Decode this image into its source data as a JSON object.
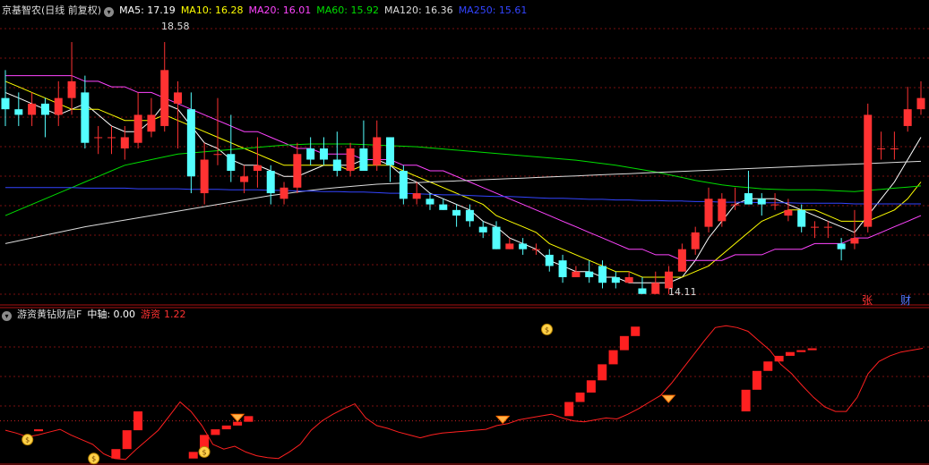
{
  "main_header": {
    "stock_name": "京基智农(日线 前复权)",
    "ma5": "MA5: 17.19",
    "ma10": "MA10: 16.28",
    "ma20": "MA20: 16.01",
    "ma60": "MA60: 15.92",
    "ma120": "MA120: 16.36",
    "ma250": "MA250: 15.61"
  },
  "sub_header": {
    "indicator_name": "游资黄钻财启F",
    "mid_axis": "中轴: 0.00",
    "hot_money_label": "游资",
    "hot_money_value": "1.22"
  },
  "annotations": {
    "high_marker": "18.58",
    "low_marker": "14.11",
    "zhang": "张",
    "cai": "财"
  },
  "colors": {
    "up": "#ff3232",
    "down": "#54ffff",
    "ma5": "#ffffff",
    "ma10": "#ffff00",
    "ma20": "#ff44ff",
    "ma60": "#00dd00",
    "ma120": "#dcdcdc",
    "ma250": "#3344ff",
    "indicator": "#ff2020",
    "grid": "#7a1010"
  },
  "chart_data": [
    {
      "type": "candlestick",
      "title": "京基智农(日线 前复权)",
      "ylim": [
        13.9,
        18.9
      ],
      "grid": true,
      "candles": [
        [
          17.5,
          17.3,
          18.0,
          17.0
        ],
        [
          17.3,
          17.2,
          17.6,
          17.0
        ],
        [
          17.2,
          17.4,
          17.6,
          17.0
        ],
        [
          17.4,
          17.2,
          17.5,
          16.8
        ],
        [
          17.2,
          17.5,
          17.8,
          17.0
        ],
        [
          17.5,
          17.8,
          18.5,
          17.2
        ],
        [
          17.6,
          16.7,
          17.9,
          16.6
        ],
        [
          16.8,
          16.8,
          17.0,
          16.5
        ],
        [
          16.8,
          16.8,
          17.0,
          16.5
        ],
        [
          16.6,
          16.8,
          17.0,
          16.4
        ],
        [
          16.7,
          17.2,
          17.6,
          16.6
        ],
        [
          16.9,
          17.2,
          17.5,
          16.8
        ],
        [
          17.0,
          18.0,
          18.5,
          16.9
        ],
        [
          17.4,
          17.6,
          17.8,
          16.6
        ],
        [
          17.3,
          16.1,
          17.6,
          15.8
        ],
        [
          15.8,
          16.4,
          16.7,
          15.6
        ],
        [
          16.5,
          16.5,
          17.5,
          16.3
        ],
        [
          16.5,
          16.2,
          17.2,
          16.0
        ],
        [
          16.0,
          16.1,
          16.3,
          15.8
        ],
        [
          16.2,
          16.3,
          16.8,
          15.9
        ],
        [
          16.2,
          15.8,
          16.3,
          15.6
        ],
        [
          15.7,
          15.9,
          16.0,
          15.6
        ],
        [
          15.9,
          16.5,
          16.7,
          15.8
        ],
        [
          16.6,
          16.4,
          16.8,
          16.3
        ],
        [
          16.6,
          16.4,
          16.8,
          16.3
        ],
        [
          16.4,
          16.2,
          16.9,
          16.1
        ],
        [
          16.2,
          16.6,
          16.7,
          16.1
        ],
        [
          16.6,
          16.2,
          17.1,
          16.2
        ],
        [
          16.3,
          16.8,
          17.1,
          16.2
        ],
        [
          16.8,
          16.3,
          16.8,
          16.0
        ],
        [
          16.2,
          15.7,
          16.3,
          15.6
        ],
        [
          15.7,
          15.8,
          16.0,
          15.6
        ],
        [
          15.7,
          15.6,
          15.8,
          15.5
        ],
        [
          15.6,
          15.5,
          15.7,
          15.5
        ],
        [
          15.5,
          15.4,
          15.6,
          15.2
        ],
        [
          15.5,
          15.3,
          15.6,
          15.2
        ],
        [
          15.2,
          15.1,
          15.3,
          15.0
        ],
        [
          15.2,
          14.8,
          15.3,
          14.8
        ],
        [
          14.8,
          14.9,
          15.0,
          14.8
        ],
        [
          14.9,
          14.8,
          15.0,
          14.7
        ],
        [
          14.8,
          14.8,
          14.9,
          14.7
        ],
        [
          14.7,
          14.5,
          14.8,
          14.4
        ],
        [
          14.6,
          14.3,
          14.7,
          14.2
        ],
        [
          14.3,
          14.4,
          14.5,
          14.3
        ],
        [
          14.4,
          14.3,
          14.6,
          14.2
        ],
        [
          14.5,
          14.2,
          14.6,
          14.1
        ],
        [
          14.3,
          14.2,
          14.4,
          14.1
        ],
        [
          14.2,
          14.3,
          14.4,
          14.2
        ],
        [
          14.1,
          14.0,
          14.3,
          14.0
        ],
        [
          14.0,
          14.2,
          14.4,
          14.0
        ],
        [
          14.1,
          14.4,
          14.5,
          14.0
        ],
        [
          14.4,
          14.8,
          14.9,
          14.4
        ],
        [
          14.8,
          15.1,
          15.2,
          14.7
        ],
        [
          15.2,
          15.7,
          15.9,
          15.1
        ],
        [
          15.3,
          15.7,
          15.8,
          15.2
        ],
        [
          15.6,
          15.6,
          15.9,
          15.5
        ],
        [
          15.8,
          15.6,
          16.2,
          15.6
        ],
        [
          15.7,
          15.6,
          15.8,
          15.4
        ],
        [
          15.6,
          15.6,
          15.8,
          15.5
        ],
        [
          15.4,
          15.5,
          15.7,
          15.3
        ],
        [
          15.5,
          15.2,
          15.6,
          15.1
        ],
        [
          15.2,
          15.2,
          15.3,
          15.0
        ],
        [
          15.2,
          15.2,
          15.3,
          15.0
        ],
        [
          14.9,
          14.8,
          15.0,
          14.6
        ],
        [
          14.9,
          15.0,
          15.5,
          14.8
        ],
        [
          15.2,
          17.2,
          17.4,
          15.1
        ],
        [
          16.6,
          16.6,
          16.9,
          16.4
        ],
        [
          16.6,
          16.6,
          16.9,
          16.4
        ],
        [
          17.0,
          17.3,
          17.7,
          16.9
        ],
        [
          17.3,
          17.5,
          17.8,
          17.2
        ]
      ],
      "series": [
        {
          "name": "MA5",
          "values": [
            17.6,
            17.5,
            17.4,
            17.3,
            17.2,
            17.3,
            17.4,
            17.2,
            17.0,
            16.9,
            16.9,
            17.1,
            17.4,
            17.3,
            17.0,
            16.7,
            16.6,
            16.4,
            16.3,
            16.3,
            16.2,
            16.1,
            16.1,
            16.2,
            16.3,
            16.3,
            16.3,
            16.4,
            16.4,
            16.3,
            16.1,
            16.0,
            15.8,
            15.7,
            15.6,
            15.5,
            15.3,
            15.2,
            15.0,
            14.9,
            14.8,
            14.6,
            14.5,
            14.4,
            14.4,
            14.3,
            14.3,
            14.2,
            14.2,
            14.2,
            14.2,
            14.3,
            14.6,
            15.0,
            15.3,
            15.6,
            15.7,
            15.7,
            15.7,
            15.6,
            15.5,
            15.4,
            15.3,
            15.2,
            15.1,
            15.4,
            15.7,
            16.0,
            16.4,
            16.8
          ]
        },
        {
          "name": "MA10",
          "values": [
            17.8,
            17.7,
            17.6,
            17.5,
            17.4,
            17.3,
            17.3,
            17.3,
            17.2,
            17.1,
            17.1,
            17.1,
            17.2,
            17.1,
            17.0,
            16.9,
            16.8,
            16.7,
            16.6,
            16.5,
            16.4,
            16.3,
            16.3,
            16.3,
            16.3,
            16.3,
            16.2,
            16.3,
            16.3,
            16.3,
            16.2,
            16.1,
            16.0,
            15.9,
            15.8,
            15.7,
            15.6,
            15.4,
            15.3,
            15.2,
            15.1,
            14.9,
            14.8,
            14.7,
            14.6,
            14.5,
            14.4,
            14.4,
            14.3,
            14.3,
            14.3,
            14.3,
            14.4,
            14.5,
            14.7,
            14.9,
            15.1,
            15.3,
            15.4,
            15.5,
            15.5,
            15.5,
            15.4,
            15.3,
            15.3,
            15.3,
            15.4,
            15.5,
            15.7,
            16.0
          ]
        },
        {
          "name": "MA20",
          "values": [
            17.9,
            17.9,
            17.9,
            17.9,
            17.9,
            17.9,
            17.8,
            17.8,
            17.7,
            17.7,
            17.6,
            17.6,
            17.5,
            17.4,
            17.3,
            17.2,
            17.1,
            17.0,
            16.9,
            16.9,
            16.8,
            16.7,
            16.6,
            16.6,
            16.5,
            16.5,
            16.5,
            16.4,
            16.4,
            16.4,
            16.3,
            16.3,
            16.2,
            16.2,
            16.1,
            16.0,
            15.9,
            15.8,
            15.7,
            15.6,
            15.5,
            15.4,
            15.3,
            15.2,
            15.1,
            15.0,
            14.9,
            14.8,
            14.8,
            14.7,
            14.7,
            14.6,
            14.6,
            14.6,
            14.6,
            14.7,
            14.7,
            14.7,
            14.8,
            14.8,
            14.8,
            14.9,
            14.9,
            14.9,
            15.0,
            15.0,
            15.1,
            15.2,
            15.3,
            15.4
          ]
        },
        {
          "name": "MA60",
          "values": [
            15.4,
            15.5,
            15.6,
            15.7,
            15.8,
            15.9,
            16.0,
            16.1,
            16.2,
            16.3,
            16.35,
            16.4,
            16.45,
            16.5,
            16.52,
            16.54,
            16.56,
            16.58,
            16.6,
            16.62,
            16.64,
            16.66,
            16.67,
            16.68,
            16.68,
            16.68,
            16.68,
            16.67,
            16.66,
            16.65,
            16.64,
            16.63,
            16.61,
            16.59,
            16.57,
            16.55,
            16.53,
            16.51,
            16.49,
            16.47,
            16.45,
            16.43,
            16.41,
            16.39,
            16.36,
            16.33,
            16.3,
            16.26,
            16.22,
            16.18,
            16.13,
            16.08,
            16.03,
            15.99,
            15.95,
            15.92,
            15.9,
            15.88,
            15.87,
            15.86,
            15.86,
            15.86,
            15.85,
            15.84,
            15.83,
            15.85,
            15.87,
            15.89,
            15.91,
            15.93
          ]
        },
        {
          "name": "MA120",
          "values": [
            14.9,
            14.95,
            15.0,
            15.05,
            15.1,
            15.15,
            15.2,
            15.24,
            15.28,
            15.32,
            15.36,
            15.4,
            15.44,
            15.48,
            15.52,
            15.56,
            15.6,
            15.64,
            15.68,
            15.72,
            15.76,
            15.79,
            15.82,
            15.85,
            15.88,
            15.9,
            15.92,
            15.94,
            15.96,
            15.97,
            15.98,
            15.99,
            16.0,
            16.01,
            16.02,
            16.03,
            16.04,
            16.05,
            16.06,
            16.07,
            16.08,
            16.09,
            16.1,
            16.11,
            16.12,
            16.13,
            16.14,
            16.15,
            16.16,
            16.17,
            16.18,
            16.19,
            16.2,
            16.21,
            16.22,
            16.23,
            16.24,
            16.25,
            16.26,
            16.27,
            16.28,
            16.29,
            16.3,
            16.31,
            16.32,
            16.33,
            16.34,
            16.35,
            16.36,
            16.37
          ]
        },
        {
          "name": "MA250",
          "values": [
            15.9,
            15.9,
            15.9,
            15.9,
            15.9,
            15.9,
            15.89,
            15.89,
            15.89,
            15.89,
            15.88,
            15.88,
            15.88,
            15.88,
            15.87,
            15.87,
            15.87,
            15.86,
            15.86,
            15.86,
            15.85,
            15.85,
            15.84,
            15.84,
            15.83,
            15.83,
            15.82,
            15.82,
            15.81,
            15.8,
            15.8,
            15.79,
            15.78,
            15.77,
            15.77,
            15.76,
            15.75,
            15.74,
            15.74,
            15.73,
            15.72,
            15.71,
            15.71,
            15.7,
            15.69,
            15.69,
            15.68,
            15.68,
            15.67,
            15.67,
            15.66,
            15.66,
            15.65,
            15.65,
            15.64,
            15.64,
            15.64,
            15.63,
            15.63,
            15.63,
            15.62,
            15.62,
            15.62,
            15.62,
            15.61,
            15.61,
            15.61,
            15.61,
            15.61,
            15.61
          ]
        }
      ]
    },
    {
      "type": "bar",
      "title": "游资黄钻财启F",
      "ylim": [
        0,
        1.5
      ],
      "line_values": [
        0.35,
        0.32,
        0.28,
        0.3,
        0.33,
        0.36,
        0.3,
        0.25,
        0.2,
        0.1,
        0.05,
        0.04,
        0.15,
        0.25,
        0.35,
        0.5,
        0.65,
        0.55,
        0.4,
        0.2,
        0.15,
        0.18,
        0.12,
        0.08,
        0.06,
        0.05,
        0.12,
        0.2,
        0.35,
        0.45,
        0.52,
        0.58,
        0.63,
        0.48,
        0.4,
        0.37,
        0.33,
        0.3,
        0.27,
        0.3,
        0.32,
        0.33,
        0.34,
        0.35,
        0.36,
        0.4,
        0.42,
        0.46,
        0.48,
        0.5,
        0.52,
        0.48,
        0.45,
        0.44,
        0.46,
        0.48,
        0.47,
        0.52,
        0.58,
        0.65,
        0.72,
        0.85,
        1.0,
        1.15,
        1.3,
        1.44,
        1.46,
        1.44,
        1.4,
        1.3,
        1.2,
        1.05,
        0.95,
        0.82,
        0.7,
        0.6,
        0.55,
        0.55,
        0.7,
        0.95,
        1.08,
        1.14,
        1.18,
        1.2,
        1.22
      ],
      "bars": [
        [
          3,
          0.34,
          0.36
        ],
        [
          10,
          0.05,
          0.15
        ],
        [
          11,
          0.15,
          0.35
        ],
        [
          12,
          0.35,
          0.55
        ],
        [
          17,
          0.05,
          0.12
        ],
        [
          18,
          0.12,
          0.3
        ],
        [
          19,
          0.3,
          0.36
        ],
        [
          20,
          0.36,
          0.4
        ],
        [
          21,
          0.4,
          0.44
        ],
        [
          22,
          0.44,
          0.5
        ],
        [
          51,
          0.5,
          0.65
        ],
        [
          52,
          0.65,
          0.75
        ],
        [
          53,
          0.75,
          0.88
        ],
        [
          54,
          0.88,
          1.05
        ],
        [
          55,
          1.05,
          1.2
        ],
        [
          56,
          1.2,
          1.35
        ],
        [
          57,
          1.35,
          1.45
        ],
        [
          67,
          0.55,
          0.78
        ],
        [
          68,
          0.78,
          0.98
        ],
        [
          69,
          0.98,
          1.08
        ],
        [
          70,
          1.08,
          1.14
        ],
        [
          71,
          1.14,
          1.18
        ],
        [
          72,
          1.18,
          1.2
        ],
        [
          73,
          1.2,
          1.22
        ]
      ],
      "money_bags": [
        [
          2,
          0.25
        ],
        [
          8,
          0.05
        ],
        [
          18,
          0.12
        ],
        [
          49,
          1.42
        ]
      ],
      "diamonds": [
        [
          21,
          0.52
        ],
        [
          45,
          0.5
        ],
        [
          60,
          0.72
        ]
      ]
    }
  ]
}
